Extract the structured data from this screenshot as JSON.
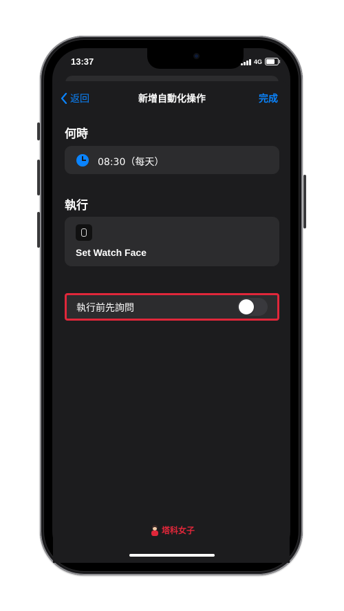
{
  "status_bar": {
    "time": "13:37",
    "network": "4G"
  },
  "nav": {
    "back_label": "返回",
    "title": "新增自動化操作",
    "done_label": "完成"
  },
  "when": {
    "section_title": "何時",
    "time_text": "08:30（每天）"
  },
  "action": {
    "section_title": "執行",
    "item_label": "Set Watch Face"
  },
  "ask_before_running": {
    "label": "執行前先詢問",
    "enabled": false
  },
  "watermark": {
    "text": "塔科女子"
  },
  "colors": {
    "accent": "#0a84ff",
    "highlight": "#e0273a",
    "background": "#1c1c1e",
    "card": "#2c2c2e"
  }
}
